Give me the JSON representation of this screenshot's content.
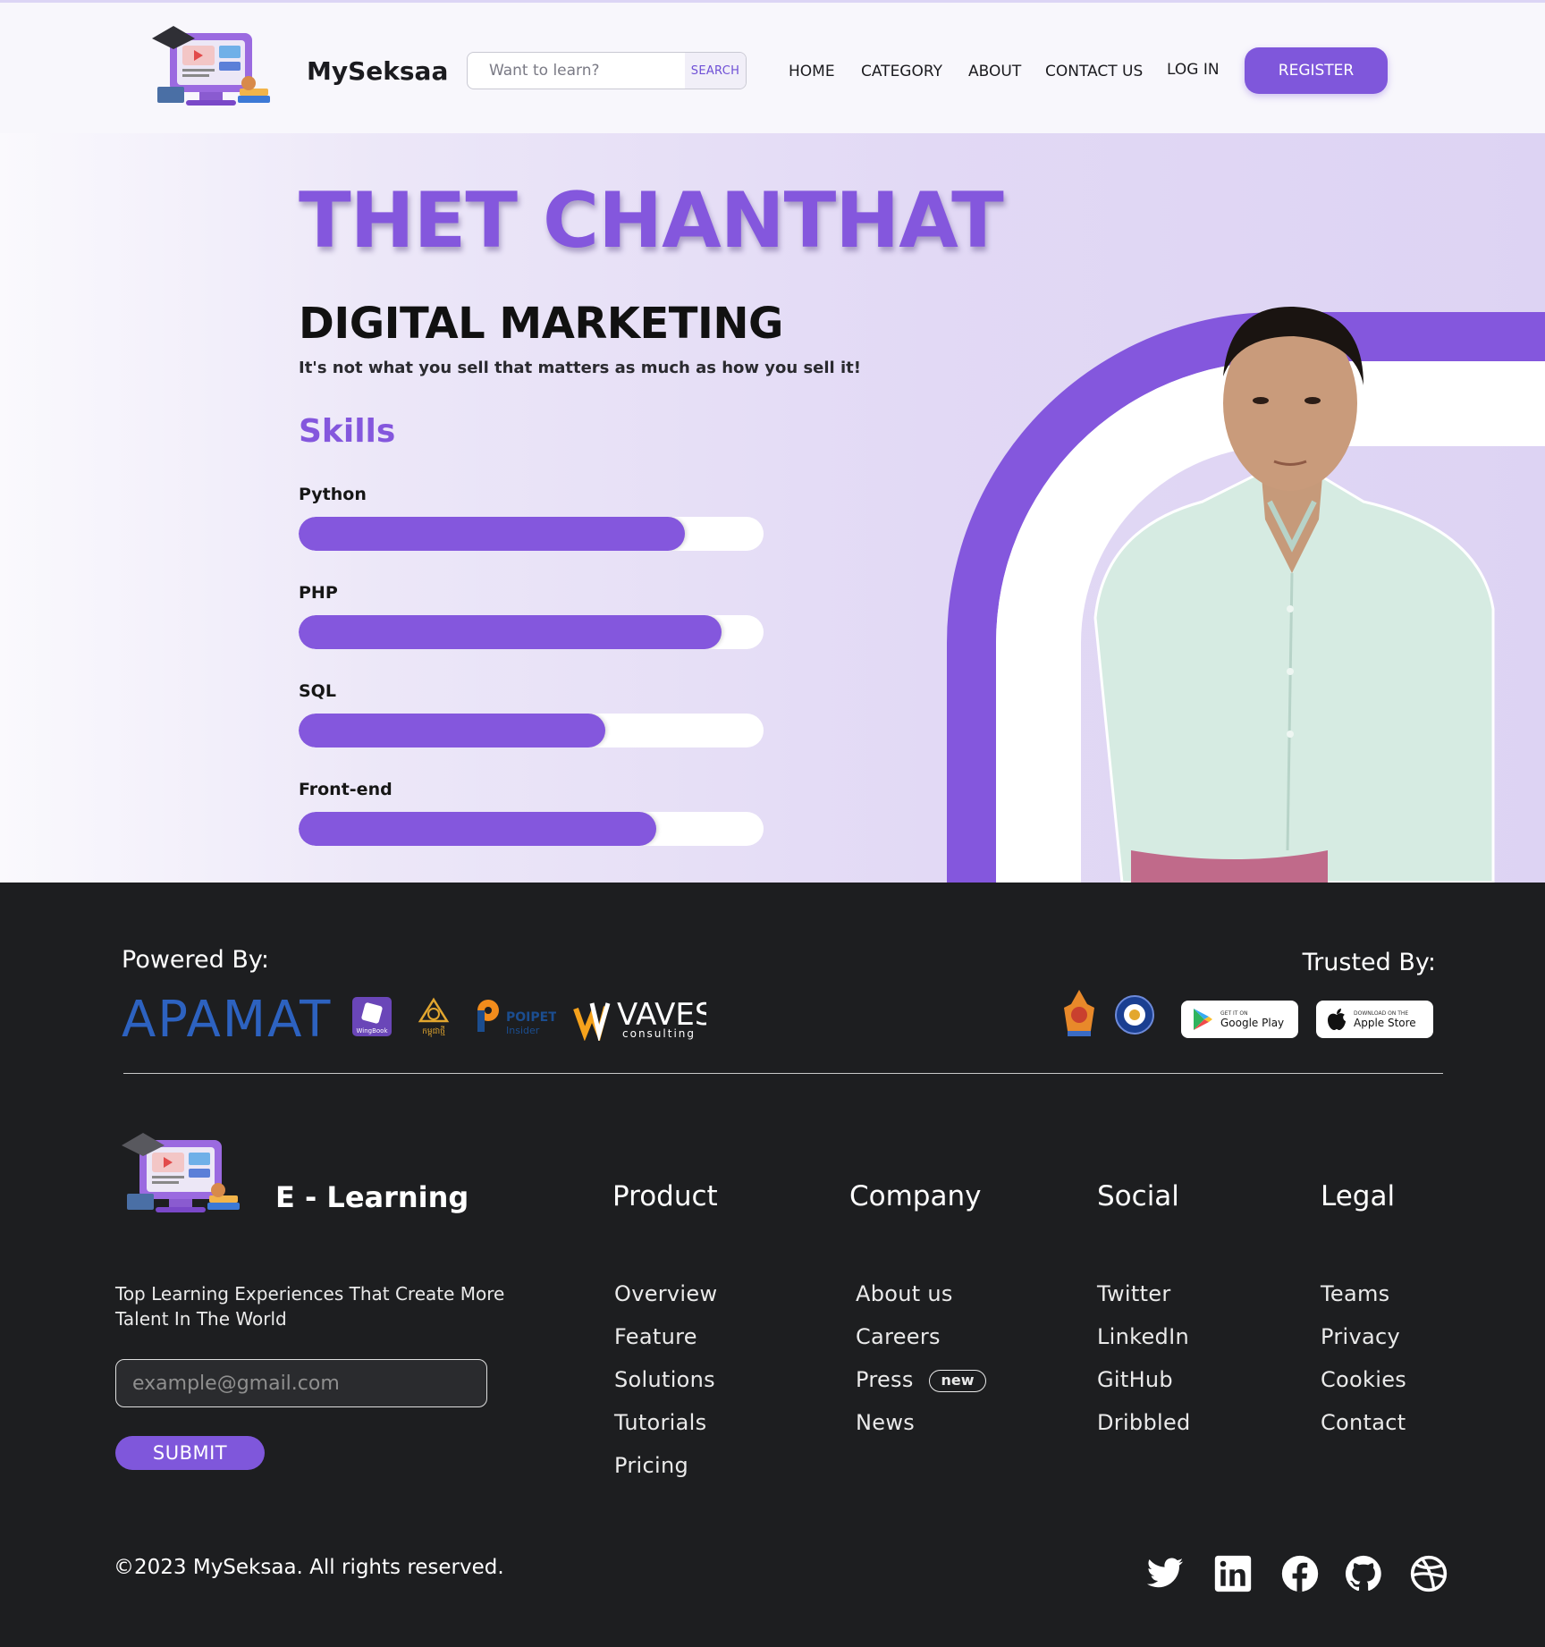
{
  "header": {
    "brand": "MySeksaa",
    "search_placeholder": "Want to learn?",
    "search_button": "SEARCH",
    "nav": [
      "HOME",
      "CATEGORY",
      "ABOUT",
      "CONTACT US",
      "LOG IN"
    ],
    "register": "REGISTER"
  },
  "hero": {
    "name": "THET CHANTHAT",
    "role": "DIGITAL MARKETING",
    "tagline": "It's not what you sell that matters as much as how you sell it!",
    "skills_title": "Skills",
    "skills": [
      {
        "label": "Python",
        "level": 0.83
      },
      {
        "label": "PHP",
        "level": 0.91
      },
      {
        "label": "SQL",
        "level": 0.66
      },
      {
        "label": "Front-end",
        "level": 0.77
      }
    ]
  },
  "footer": {
    "powered_by": "Powered By:",
    "trusted_by": "Trusted By:",
    "partners": {
      "apamat": "APAMAT",
      "wingbook": "WingBook",
      "kalbakyo": "កម្ពុជាថ្មី",
      "poipet": "POIPET",
      "poipet_sub": "Insider",
      "waves": "VAVES",
      "waves_sub": "consulting"
    },
    "stores": [
      {
        "small": "GET IT ON",
        "big": "Google Play",
        "icon": "google-play-icon"
      },
      {
        "small": "DOWNLOAD ON THE",
        "big": "Apple Store",
        "icon": "apple-icon"
      }
    ],
    "brand": "E - Learning",
    "description": "Top Learning Experiences That Create More Talent In The World",
    "email_placeholder": "example@gmail.com",
    "submit": "SUBMIT",
    "columns": [
      {
        "title": "Product",
        "links": [
          "Overview",
          "Feature",
          "Solutions",
          "Tutorials",
          "Pricing"
        ]
      },
      {
        "title": "Company",
        "links": [
          "About us",
          "Careers",
          "Press",
          "News"
        ]
      },
      {
        "title": "Social",
        "links": [
          "Twitter",
          "LinkedIn",
          "GitHub",
          "Dribbled"
        ]
      },
      {
        "title": "Legal",
        "links": [
          "Teams",
          "Privacy",
          "Cookies",
          "Contact"
        ]
      }
    ],
    "press_badge": "new",
    "copyright": "©2023 MySeksaa. All rights reserved.",
    "social_icons": [
      "twitter-icon",
      "linkedin-icon",
      "facebook-icon",
      "github-icon",
      "dribbble-icon"
    ]
  },
  "colors": {
    "accent": "#8457dd",
    "footer_bg": "#1d1e20",
    "header_bg": "#f8f7fc"
  }
}
